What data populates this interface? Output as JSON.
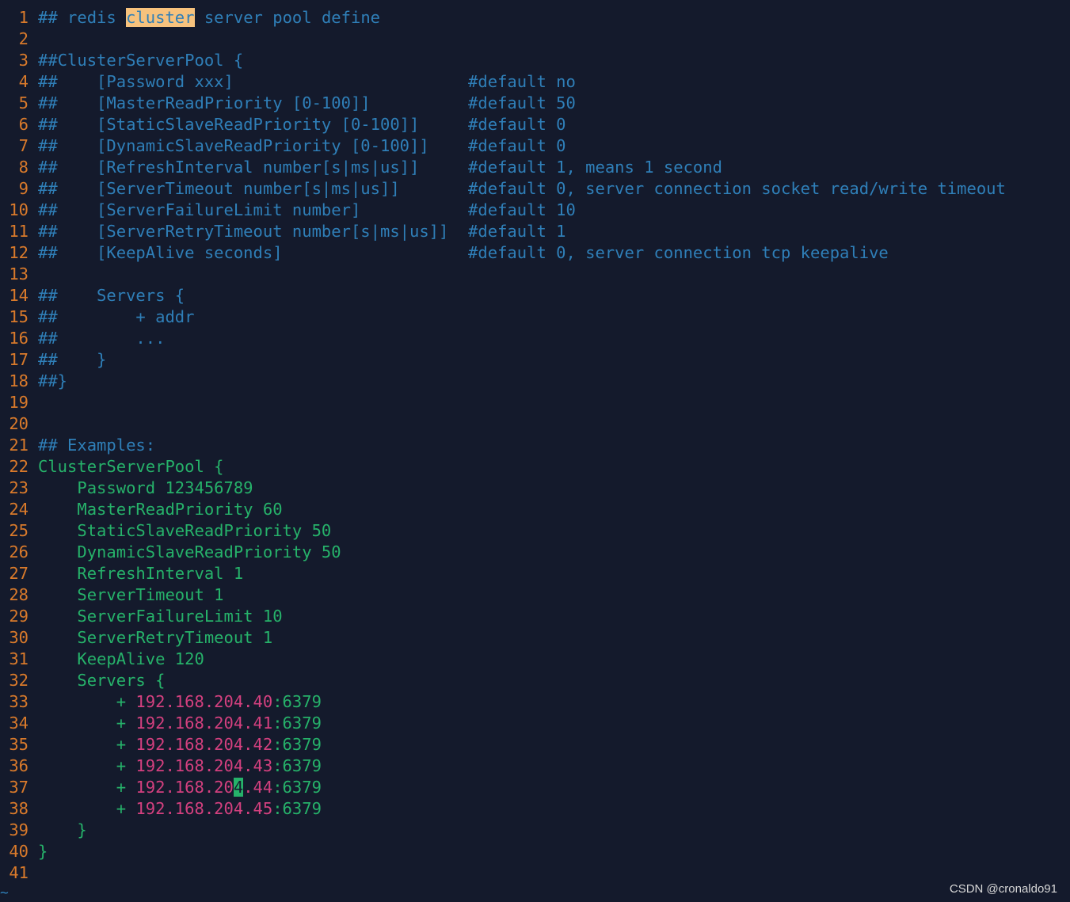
{
  "editor": {
    "colors": {
      "background": "#141a2c",
      "line_number": "#d97a2b",
      "comment": "#2f7fb8",
      "code": "#26b26a",
      "ip": "#d4407f",
      "search_highlight": "#f7c27d",
      "cursor": "#26b26a"
    },
    "lines": [
      {
        "n": "1",
        "cls": "cmt",
        "segs": [
          {
            "t": "## redis "
          },
          {
            "t": "cluster",
            "cls": "hl"
          },
          {
            "t": " server pool define"
          }
        ]
      },
      {
        "n": "2",
        "cls": "cmt",
        "segs": []
      },
      {
        "n": "3",
        "cls": "cmt",
        "segs": [
          {
            "t": "##ClusterServerPool {"
          }
        ]
      },
      {
        "n": "4",
        "cls": "cmt",
        "segs": [
          {
            "t": "##    [Password xxx]                        #default no"
          }
        ]
      },
      {
        "n": "5",
        "cls": "cmt",
        "segs": [
          {
            "t": "##    [MasterReadPriority [0-100]]          #default 50"
          }
        ]
      },
      {
        "n": "6",
        "cls": "cmt",
        "segs": [
          {
            "t": "##    [StaticSlaveReadPriority [0-100]]     #default 0"
          }
        ]
      },
      {
        "n": "7",
        "cls": "cmt",
        "segs": [
          {
            "t": "##    [DynamicSlaveReadPriority [0-100]]    #default 0"
          }
        ]
      },
      {
        "n": "8",
        "cls": "cmt",
        "segs": [
          {
            "t": "##    [RefreshInterval number[s|ms|us]]     #default 1, means 1 second"
          }
        ]
      },
      {
        "n": "9",
        "cls": "cmt",
        "segs": [
          {
            "t": "##    [ServerTimeout number[s|ms|us]]       #default 0, server connection socket read/write timeout"
          }
        ]
      },
      {
        "n": "10",
        "cls": "cmt",
        "segs": [
          {
            "t": "##    [ServerFailureLimit number]           #default 10"
          }
        ]
      },
      {
        "n": "11",
        "cls": "cmt",
        "segs": [
          {
            "t": "##    [ServerRetryTimeout number[s|ms|us]]  #default 1"
          }
        ]
      },
      {
        "n": "12",
        "cls": "cmt",
        "segs": [
          {
            "t": "##    [KeepAlive seconds]                   #default 0, server connection tcp keepalive"
          }
        ]
      },
      {
        "n": "13",
        "cls": "cmt",
        "segs": []
      },
      {
        "n": "14",
        "cls": "cmt",
        "segs": [
          {
            "t": "##    Servers {"
          }
        ]
      },
      {
        "n": "15",
        "cls": "cmt",
        "segs": [
          {
            "t": "##        + addr"
          }
        ]
      },
      {
        "n": "16",
        "cls": "cmt",
        "segs": [
          {
            "t": "##        ..."
          }
        ]
      },
      {
        "n": "17",
        "cls": "cmt",
        "segs": [
          {
            "t": "##    }"
          }
        ]
      },
      {
        "n": "18",
        "cls": "cmt",
        "segs": [
          {
            "t": "##}"
          }
        ]
      },
      {
        "n": "19",
        "cls": "cmt",
        "segs": []
      },
      {
        "n": "20",
        "cls": "cmt",
        "segs": []
      },
      {
        "n": "21",
        "cls": "cmt",
        "segs": [
          {
            "t": "## Examples:"
          }
        ]
      },
      {
        "n": "22",
        "cls": "code",
        "segs": [
          {
            "t": "ClusterServerPool {"
          }
        ]
      },
      {
        "n": "23",
        "cls": "code",
        "segs": [
          {
            "t": "    Password 123456789"
          }
        ]
      },
      {
        "n": "24",
        "cls": "code",
        "segs": [
          {
            "t": "    MasterReadPriority 60"
          }
        ]
      },
      {
        "n": "25",
        "cls": "code",
        "segs": [
          {
            "t": "    StaticSlaveReadPriority 50"
          }
        ]
      },
      {
        "n": "26",
        "cls": "code",
        "segs": [
          {
            "t": "    DynamicSlaveReadPriority 50"
          }
        ]
      },
      {
        "n": "27",
        "cls": "code",
        "segs": [
          {
            "t": "    RefreshInterval 1"
          }
        ]
      },
      {
        "n": "28",
        "cls": "code",
        "segs": [
          {
            "t": "    ServerTimeout 1"
          }
        ]
      },
      {
        "n": "29",
        "cls": "code",
        "segs": [
          {
            "t": "    ServerFailureLimit 10"
          }
        ]
      },
      {
        "n": "30",
        "cls": "code",
        "segs": [
          {
            "t": "    ServerRetryTimeout 1"
          }
        ]
      },
      {
        "n": "31",
        "cls": "code",
        "segs": [
          {
            "t": "    KeepAlive 120"
          }
        ]
      },
      {
        "n": "32",
        "cls": "code",
        "segs": [
          {
            "t": "    Servers {"
          }
        ]
      },
      {
        "n": "33",
        "cls": "code",
        "segs": [
          {
            "t": "        + "
          },
          {
            "t": "192.168.204.40",
            "cls": "ip"
          },
          {
            "t": ":6379",
            "cls": "port"
          }
        ]
      },
      {
        "n": "34",
        "cls": "code",
        "segs": [
          {
            "t": "        + "
          },
          {
            "t": "192.168.204.41",
            "cls": "ip"
          },
          {
            "t": ":6379",
            "cls": "port"
          }
        ]
      },
      {
        "n": "35",
        "cls": "code",
        "segs": [
          {
            "t": "        + "
          },
          {
            "t": "192.168.204.42",
            "cls": "ip"
          },
          {
            "t": ":6379",
            "cls": "port"
          }
        ]
      },
      {
        "n": "36",
        "cls": "code",
        "segs": [
          {
            "t": "        + "
          },
          {
            "t": "192.168.204.43",
            "cls": "ip"
          },
          {
            "t": ":6379",
            "cls": "port"
          }
        ]
      },
      {
        "n": "37",
        "cls": "code",
        "segs": [
          {
            "t": "        + "
          },
          {
            "t": "192.168.20",
            "cls": "ip"
          },
          {
            "t": "4",
            "cls": "cursor"
          },
          {
            "t": ".44",
            "cls": "ip"
          },
          {
            "t": ":6379",
            "cls": "port"
          }
        ]
      },
      {
        "n": "38",
        "cls": "code",
        "segs": [
          {
            "t": "        + "
          },
          {
            "t": "192.168.204.45",
            "cls": "ip"
          },
          {
            "t": ":6379",
            "cls": "port"
          }
        ]
      },
      {
        "n": "39",
        "cls": "code",
        "segs": [
          {
            "t": "    }"
          }
        ]
      },
      {
        "n": "40",
        "cls": "code",
        "segs": [
          {
            "t": "}"
          }
        ]
      },
      {
        "n": "41",
        "cls": "code",
        "segs": []
      }
    ],
    "tilde": "~"
  },
  "watermark": "CSDN @cronaldo91"
}
